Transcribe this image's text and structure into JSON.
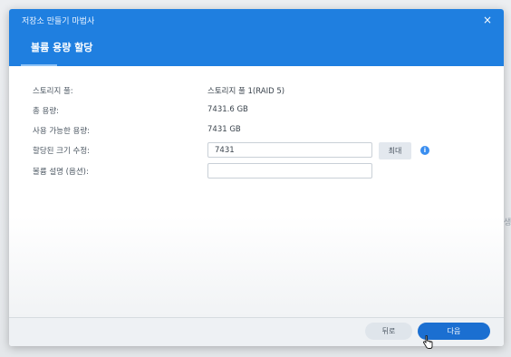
{
  "window": {
    "title": "저장소 만들기 마법사",
    "close_glyph": "×"
  },
  "page": {
    "title": "볼륨 용량 할당"
  },
  "rows": {
    "storage_pool": {
      "label": "스토리지 풀:",
      "value": "스토리지 풀 1(RAID 5)"
    },
    "total_capacity": {
      "label": "총 용량:",
      "value": "7431.6 GB"
    },
    "available_capacity": {
      "label": "사용 가능한 용량:",
      "value": "7431 GB"
    },
    "allocated_size": {
      "label": "할당된 크기 수정:",
      "value": "7431"
    },
    "volume_description": {
      "label": "볼륨 설명 (옵션):",
      "value": ""
    }
  },
  "buttons": {
    "max": "최대",
    "back": "뒤로",
    "next": "다음"
  },
  "icons": {
    "info": "info-icon",
    "close": "close-icon",
    "cursor": "hand-pointer-icon"
  },
  "colors": {
    "header": "#1f7fe0",
    "next_button": "#1b6fd1",
    "info_icon": "#3a8ef0"
  }
}
